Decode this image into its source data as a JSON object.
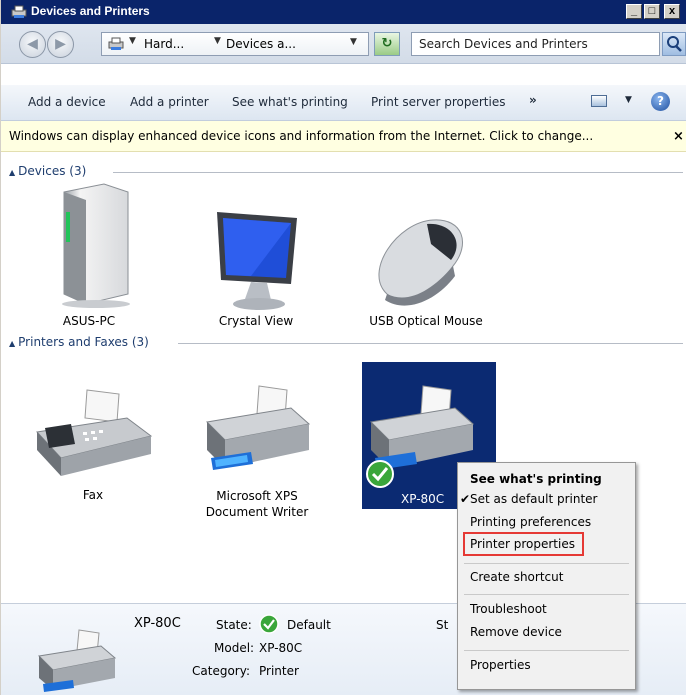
{
  "window": {
    "title": "Devices and Printers"
  },
  "titlebar_buttons": {
    "minimize": "_",
    "maximize": "□",
    "close": "x"
  },
  "address": {
    "crumbs": [
      "Hard...",
      "Devices a..."
    ],
    "search_placeholder": "Search Devices and Printers"
  },
  "toolbar": {
    "items": [
      "Add a device",
      "Add a printer",
      "See what's printing",
      "Print server properties"
    ],
    "more": "»",
    "help": "?"
  },
  "infobar": {
    "message": "Windows can display enhanced device icons and information from the Internet. Click to change...",
    "close": "×"
  },
  "groups": {
    "devices": {
      "header": "Devices (3)",
      "items": [
        "ASUS-PC",
        "Crystal View",
        "USB Optical Mouse"
      ]
    },
    "printers": {
      "header": "Printers and Faxes (3)",
      "items": [
        "Fax",
        "Microsoft XPS Document Writer",
        "XP-80C"
      ]
    }
  },
  "context_menu": {
    "items": [
      {
        "label": "See what's printing",
        "bold": true
      },
      {
        "label": "Set as default printer",
        "checked": true
      },
      {
        "label": "Printing preferences"
      },
      {
        "label": "Printer properties",
        "highlighted": true
      },
      {
        "label": "Create shortcut"
      },
      {
        "label": "Troubleshoot"
      },
      {
        "label": "Remove device"
      },
      {
        "label": "Properties"
      }
    ]
  },
  "details": {
    "name": "XP-80C",
    "state_label": "State:",
    "state_value": "Default",
    "model_label": "Model:",
    "model_value": "XP-80C",
    "category_label": "Category:",
    "category_value": "Printer",
    "status_label": "St"
  },
  "colors": {
    "titlebar": "#0a246a",
    "selection": "#0b2a72",
    "highlight_box": "#e53935",
    "infobar": "#ffffe1"
  }
}
